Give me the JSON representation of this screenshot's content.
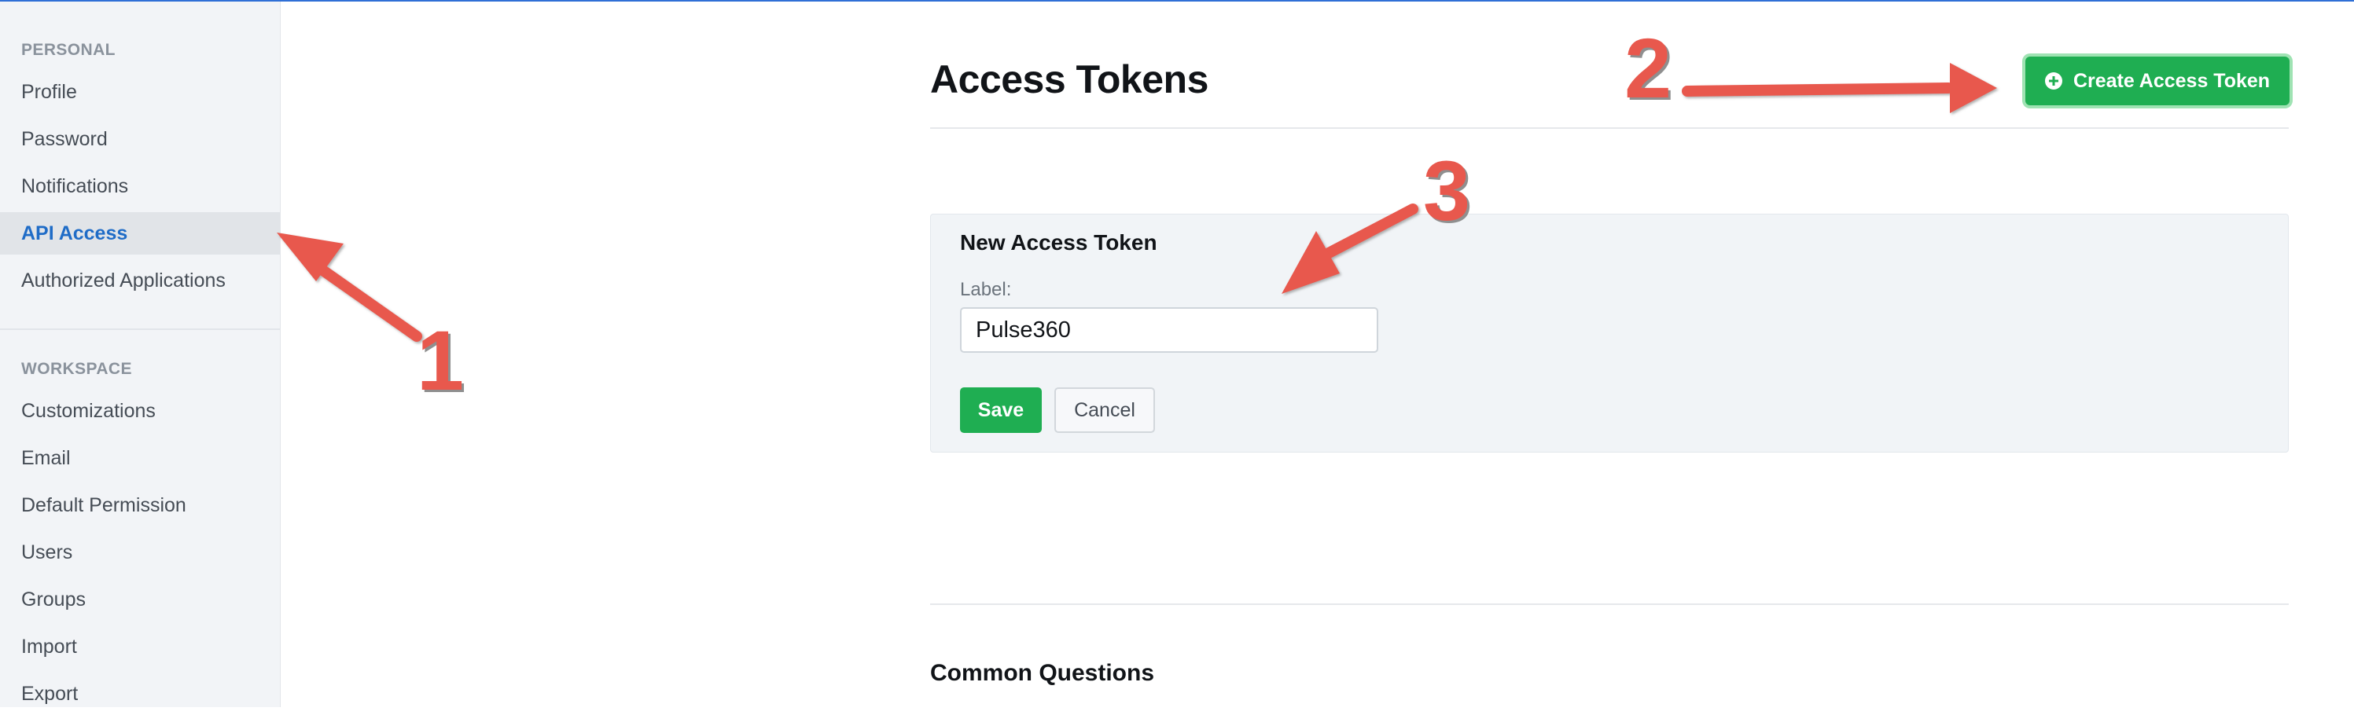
{
  "sidebar": {
    "personal_heading": "PERSONAL",
    "personal_items": [
      {
        "label": "Profile"
      },
      {
        "label": "Password"
      },
      {
        "label": "Notifications"
      },
      {
        "label": "API Access"
      },
      {
        "label": "Authorized Applications"
      }
    ],
    "active_item": "API Access",
    "workspace_heading": "WORKSPACE",
    "workspace_items": [
      {
        "label": "Customizations"
      },
      {
        "label": "Email"
      },
      {
        "label": "Default Permission"
      },
      {
        "label": "Users"
      },
      {
        "label": "Groups"
      },
      {
        "label": "Import"
      },
      {
        "label": "Export"
      }
    ]
  },
  "main": {
    "title": "Access Tokens",
    "create_button_label": "Create Access Token",
    "new_token": {
      "title": "New Access Token",
      "label_text": "Label:",
      "label_value": "Pulse360",
      "save_label": "Save",
      "cancel_label": "Cancel"
    },
    "common_questions_title": "Common Questions"
  },
  "annotations": {
    "step1": "1",
    "step2": "2",
    "step3": "3"
  },
  "colors": {
    "accent_blue": "#1f6cc7",
    "primary_green": "#1fae52",
    "annotation_red": "#e8584d"
  }
}
